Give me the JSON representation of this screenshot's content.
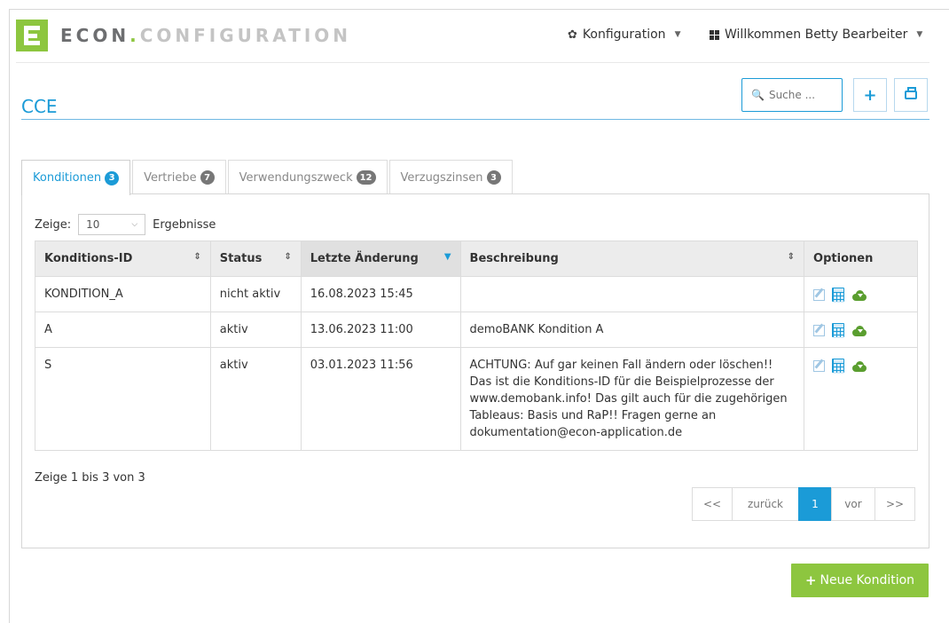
{
  "brand": {
    "part1": "ECON",
    "dot": ".",
    "part2": "CONFIGURATION"
  },
  "nav": {
    "config_label": "Konfiguration",
    "user_label": "Willkommen Betty Bearbeiter"
  },
  "page": {
    "title": "CCE",
    "search_placeholder": "Suche ...",
    "add_label": "+"
  },
  "tabs": [
    {
      "label": "Konditionen",
      "count": "3"
    },
    {
      "label": "Vertriebe",
      "count": "7"
    },
    {
      "label": "Verwendungszweck",
      "count": "12"
    },
    {
      "label": "Verzugszinsen",
      "count": "3"
    }
  ],
  "length": {
    "prefix": "Zeige:",
    "value": "10",
    "suffix": "Ergebnisse"
  },
  "table": {
    "headers": [
      "Konditions-ID",
      "Status",
      "Letzte Änderung",
      "Beschreibung",
      "Optionen"
    ],
    "rows": [
      {
        "id": "KONDITION_A",
        "status": "nicht aktiv",
        "date": "16.08.2023 15:45",
        "desc": ""
      },
      {
        "id": "A",
        "status": "aktiv",
        "date": "13.06.2023 11:00",
        "desc": "demoBANK Kondition A"
      },
      {
        "id": "S",
        "status": "aktiv",
        "date": "03.01.2023 11:56",
        "desc": "ACHTUNG: Auf gar keinen Fall ändern oder löschen!! Das ist die Konditions-ID für die Beispielprozesse der www.demobank.info! Das gilt auch für die zugehörigen Tableaus: Basis und RaP!! Fragen gerne an dokumentation@econ-application.de"
      }
    ]
  },
  "info": "Zeige 1 bis 3 von 3",
  "pager": {
    "first": "<<",
    "prev": "zurück",
    "current": "1",
    "next": "vor",
    "last": ">>"
  },
  "new_button": "Neue Kondition",
  "colors": {
    "brand_green": "#8dc63f",
    "accent_blue": "#1b9bd7",
    "cloud_green": "#5a9e2f"
  },
  "icons": [
    "gear-icon",
    "grid-icon",
    "search-icon",
    "plus-icon",
    "printer-icon",
    "edit-icon",
    "calculator-icon",
    "cloud-download-icon"
  ]
}
